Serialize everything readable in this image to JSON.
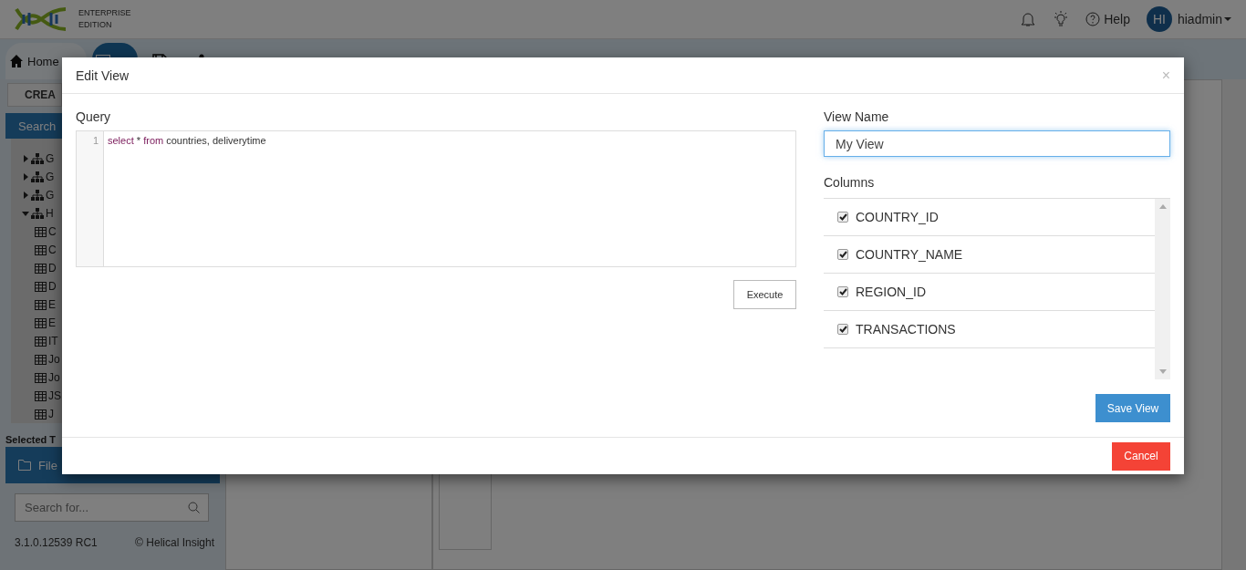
{
  "header": {
    "edition": [
      "ENTERPRISE",
      "EDITION"
    ],
    "help": "Help",
    "avatar": "HI",
    "user": "hiadmin"
  },
  "tabs": [
    {
      "label": "Home",
      "selected": false
    },
    {
      "selected": true
    }
  ],
  "sidebar": {
    "create_button": "CREA",
    "search_tab": "Search",
    "tree": [
      {
        "label": "G",
        "kind": "schema",
        "expanded": false
      },
      {
        "label": "G",
        "kind": "schema",
        "expanded": false
      },
      {
        "label": "G",
        "kind": "schema",
        "expanded": false
      },
      {
        "label": "H",
        "kind": "schema",
        "expanded": true,
        "children": [
          {
            "label": "C",
            "kind": "table"
          },
          {
            "label": "C",
            "kind": "table"
          },
          {
            "label": "D",
            "kind": "table"
          },
          {
            "label": "D",
            "kind": "table"
          },
          {
            "label": "E",
            "kind": "table"
          },
          {
            "label": "E",
            "kind": "table"
          },
          {
            "label": "IT",
            "kind": "table"
          },
          {
            "label": "Jo",
            "kind": "table"
          },
          {
            "label": "Jo",
            "kind": "table"
          },
          {
            "label": "JS",
            "kind": "table"
          },
          {
            "label": "J",
            "kind": "table"
          }
        ]
      }
    ],
    "selected_label": "Selected T",
    "file_browser": "File",
    "search_placeholder": "Search for...",
    "version": "3.1.0.12539 RC1",
    "copyright": "© Helical Insight"
  },
  "modal": {
    "title": "Edit View",
    "close": "×",
    "query_label": "Query",
    "query_lines": [
      {
        "number": "1",
        "tokens": [
          {
            "text": "select",
            "kind": "keyword"
          },
          {
            "text": " * ",
            "kind": "plain"
          },
          {
            "text": "from",
            "kind": "keyword"
          },
          {
            "text": " countries, deliverytime",
            "kind": "plain"
          }
        ]
      }
    ],
    "execute": "Execute",
    "view_name_label": "View Name",
    "view_name": "My View",
    "columns_label": "Columns",
    "columns": [
      {
        "name": "COUNTRY_ID",
        "checked": true
      },
      {
        "name": "COUNTRY_NAME",
        "checked": true
      },
      {
        "name": "REGION_ID",
        "checked": true
      },
      {
        "name": "TRANSACTIONS",
        "checked": true
      }
    ],
    "save": "Save View",
    "cancel": "Cancel"
  }
}
